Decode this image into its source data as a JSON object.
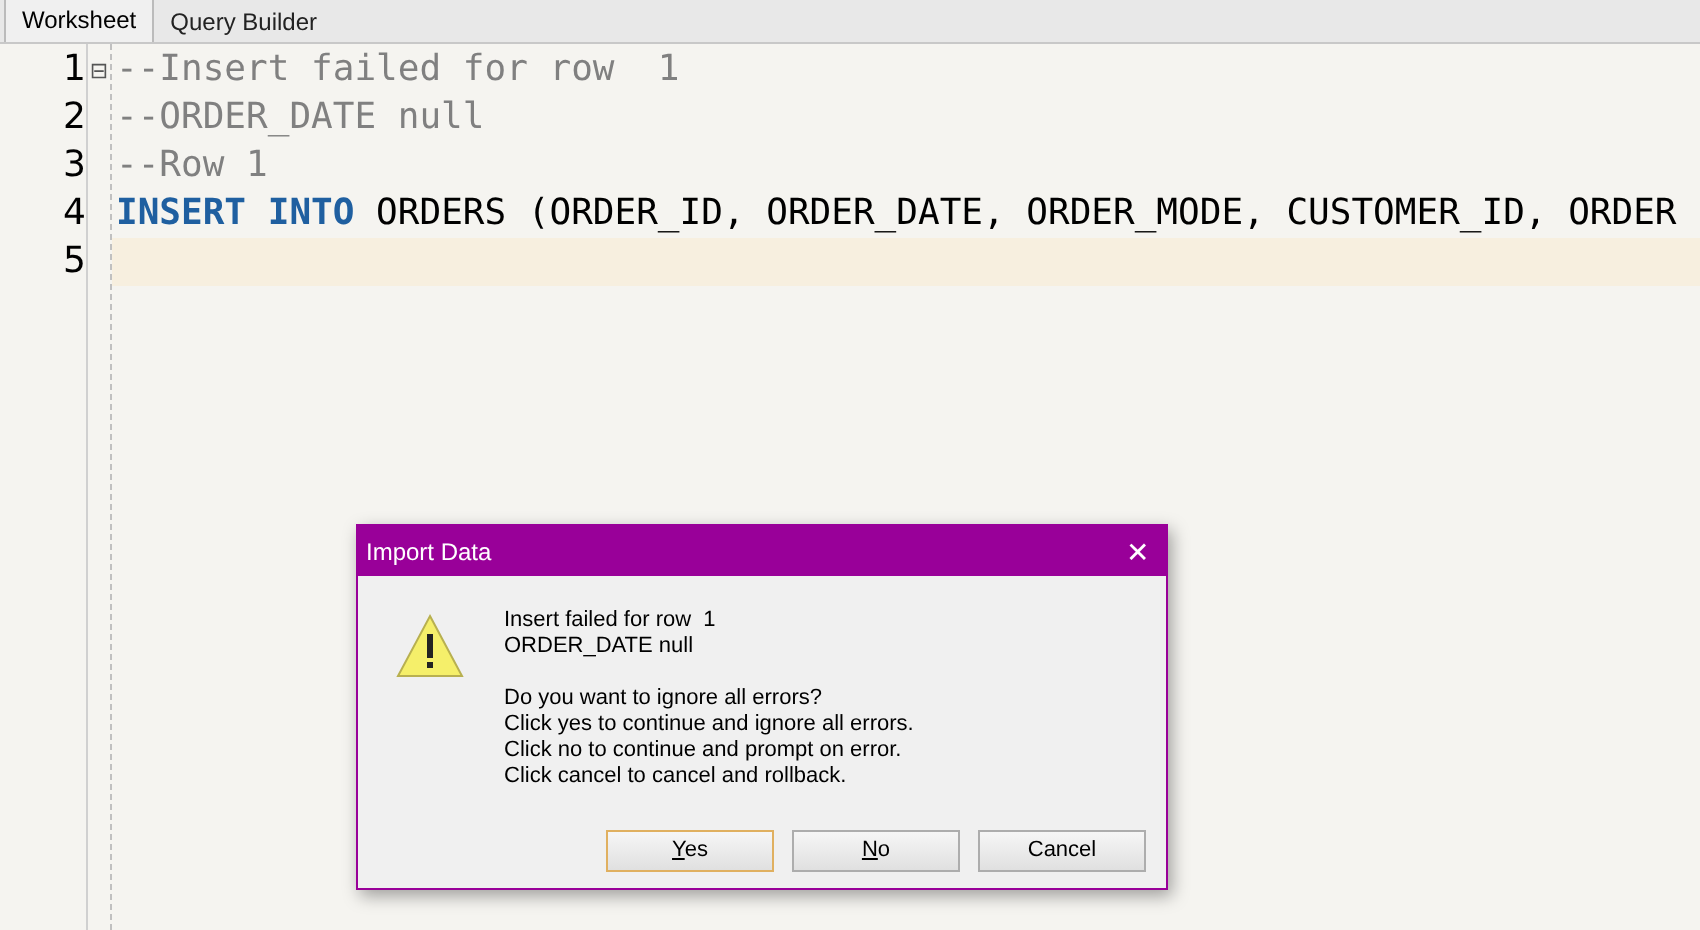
{
  "tabs": [
    {
      "label": "Worksheet",
      "selected": true
    },
    {
      "label": "Query Builder",
      "selected": false
    }
  ],
  "editor": {
    "lines": [
      {
        "number": "1",
        "current": false,
        "fold_marker": "⊟",
        "tokens": [
          {
            "text": "--Insert failed for row  1",
            "kind": "comment"
          }
        ]
      },
      {
        "number": "2",
        "current": false,
        "tokens": [
          {
            "text": "--ORDER_DATE null",
            "kind": "comment"
          }
        ]
      },
      {
        "number": "3",
        "current": false,
        "tokens": [
          {
            "text": "--Row 1",
            "kind": "comment"
          }
        ]
      },
      {
        "number": "4",
        "current": false,
        "tokens": [
          {
            "text": "INSERT ",
            "kind": "keyword"
          },
          {
            "text": "INTO",
            "kind": "keyword"
          },
          {
            "text": " ORDERS (ORDER_ID, ORDER_DATE, ORDER_MODE, CUSTOMER_ID, ORDER",
            "kind": "plain"
          }
        ]
      },
      {
        "number": "5",
        "current": true
      }
    ]
  },
  "dialog": {
    "title": "Import Data",
    "close": "✕",
    "message": [
      "Insert failed for row  1",
      "ORDER_DATE null"
    ],
    "question": [
      "Do you want to ignore all errors?",
      "Click yes to continue and ignore all errors.",
      "Click no to continue and prompt on error.",
      "Click cancel to cancel and rollback."
    ],
    "buttons": [
      {
        "label": "Yes",
        "focused": true,
        "mnemonic_underlined": true
      },
      {
        "label": "No",
        "focused": false,
        "mnemonic_underlined": true
      },
      {
        "label": "Cancel",
        "focused": false,
        "mnemonic_underlined": false
      }
    ]
  }
}
